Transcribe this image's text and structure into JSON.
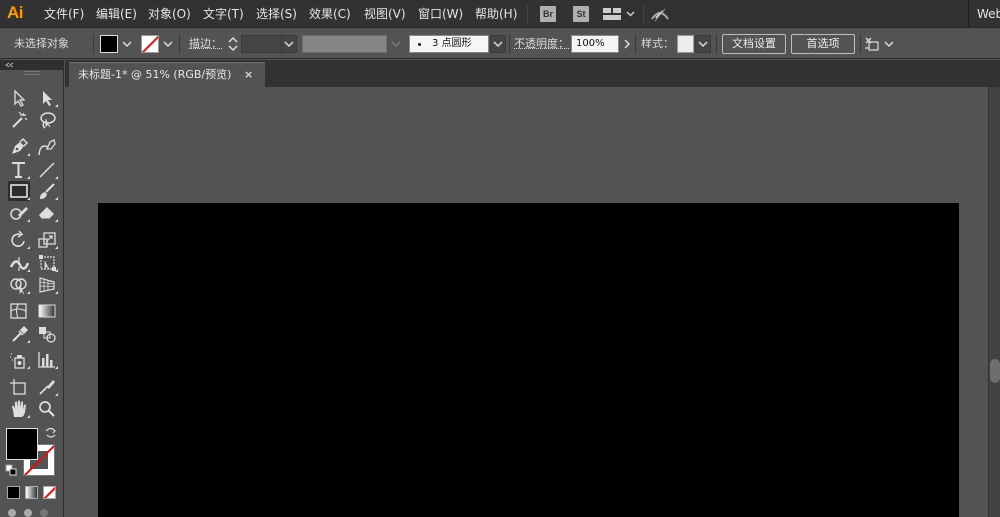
{
  "app": {
    "logo": "Ai"
  },
  "menu": [
    "文件(F)",
    "编辑(E)",
    "对象(O)",
    "文字(T)",
    "选择(S)",
    "效果(C)",
    "视图(V)",
    "窗口(W)",
    "帮助(H)"
  ],
  "menubar_icons": {
    "bridge": "Br",
    "stock": "St",
    "workspace": "workspace-switcher-icon",
    "gpu": "gpu-performance-icon"
  },
  "workspace_label": "Web",
  "control": {
    "selection_status": "未选择对象",
    "stroke_label": "描边：",
    "brush_value": "3 点圆形",
    "opacity_label": "不透明度：",
    "opacity_value": "100%",
    "style_label": "样式：",
    "doc_setup_button": "文档设置",
    "preferences_button": "首选项"
  },
  "document": {
    "tab_title": "未标题-1* @ 51% (RGB/预览)",
    "close_glyph": "×"
  },
  "colors": {
    "menubar_bg": "#323232",
    "panel_bg": "#535353",
    "ai_orange": "#ff9a00",
    "artboard": "#000000",
    "fill": "#000000",
    "stroke_none_slash": "#e01010"
  }
}
